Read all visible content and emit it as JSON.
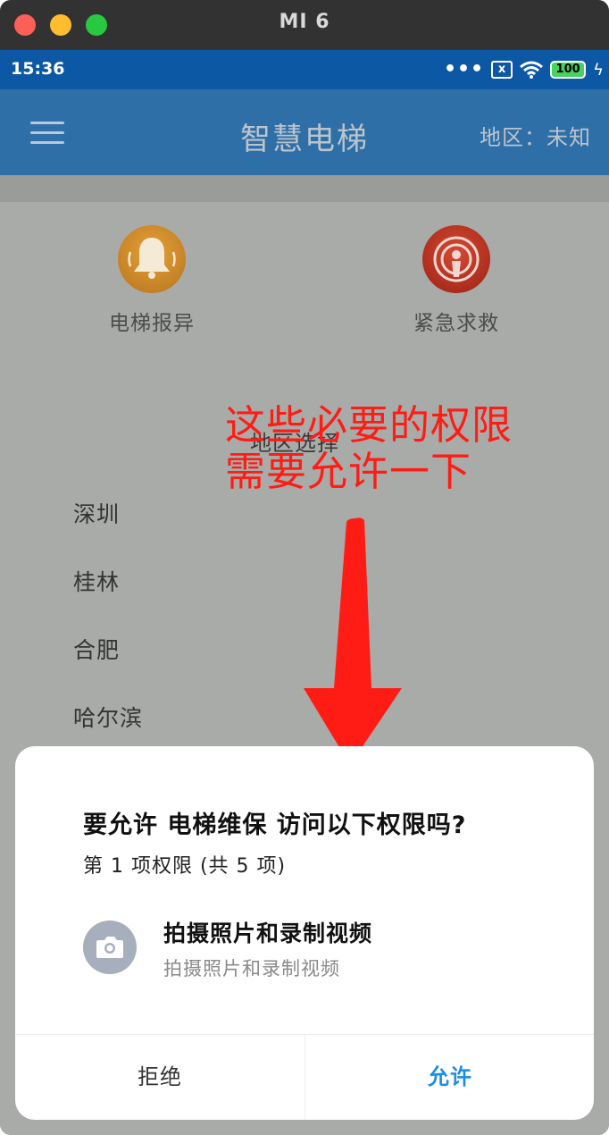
{
  "window": {
    "title": "MI 6"
  },
  "statusbar": {
    "time": "15:36",
    "dots": "•••",
    "sim": "x",
    "battery": "100",
    "bolt": "ϟ"
  },
  "appbar": {
    "title": "智慧电梯",
    "region": "地区：未知"
  },
  "features": [
    {
      "label": "电梯报异",
      "icon": "bell-icon"
    },
    {
      "label": "紧急求救",
      "icon": "sos-icon"
    }
  ],
  "region_select": {
    "title": "地区选择",
    "cities": [
      "深圳",
      "桂林",
      "合肥",
      "哈尔滨"
    ]
  },
  "annotation": {
    "line1": "这些必要的权限",
    "line2": "需要允许一下",
    "color": "#ff1c14"
  },
  "dialog": {
    "title": "要允许 电梯维保 访问以下权限吗?",
    "subtitle": "第 1 项权限 (共 5 项)",
    "permission": {
      "name": "拍摄照片和录制视频",
      "description": "拍摄照片和录制视频",
      "icon": "camera-icon"
    },
    "deny_label": "拒绝",
    "allow_label": "允许",
    "allow_color": "#1e8ee0"
  },
  "colors": {
    "statusbar": "#0c58a5",
    "appbar": "#2f6fa8",
    "scrim": "#a9aba9"
  }
}
